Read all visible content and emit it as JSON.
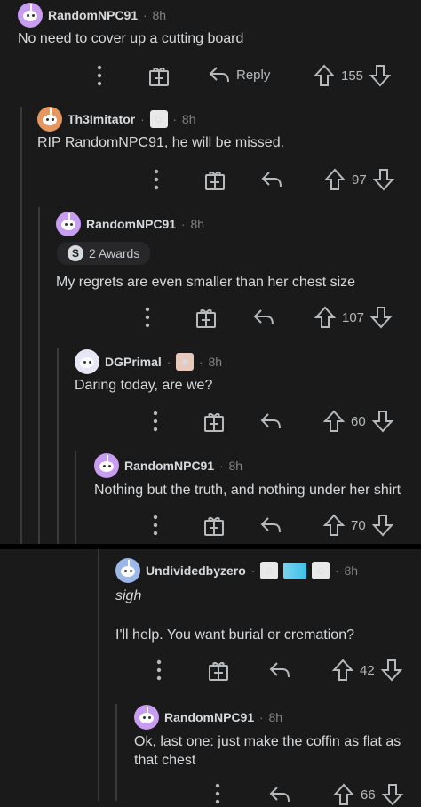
{
  "colors": {
    "background": "#1a1a1b",
    "text": "#d7dadc",
    "muted": "#818384",
    "thread": "#3a3a3c",
    "separator": "#000000"
  },
  "comments": [
    {
      "username": "RandomNPC91",
      "time": "8h",
      "text": "No need to cover up a cutting board",
      "reply_label": "Reply",
      "votes": "155",
      "avatar_color": "#c89cf0"
    },
    {
      "username": "Th3Imitator",
      "time": "8h",
      "text": "RIP RandomNPC91, he will be missed.",
      "votes": "97",
      "avatar_color": "#e5975d"
    },
    {
      "username": "RandomNPC91",
      "time": "8h",
      "awards": "2 Awards",
      "text": "My regrets are even smaller than her chest size",
      "votes": "107",
      "avatar_color": "#c89cf0"
    },
    {
      "username": "DGPrimal",
      "time": "8h",
      "text": "Daring today, are we?",
      "votes": "60",
      "avatar_color": "#e6e6f5"
    },
    {
      "username": "RandomNPC91",
      "time": "8h",
      "text": "Nothing but the truth, and nothing under her shirt",
      "votes": "70",
      "avatar_color": "#c89cf0"
    },
    {
      "username": "Undividedbyzero",
      "time": "8h",
      "text_line1": "sigh",
      "text_line2": "I'll help. You want burial or cremation?",
      "votes": "42",
      "avatar_color": "#9bb8e8"
    },
    {
      "username": "RandomNPC91",
      "time": "8h",
      "text_line1": "Ok, last one: just make the coffin as flat as",
      "text_line2": "that chest",
      "votes": "66",
      "avatar_color": "#c89cf0"
    }
  ],
  "award_badge": "S"
}
